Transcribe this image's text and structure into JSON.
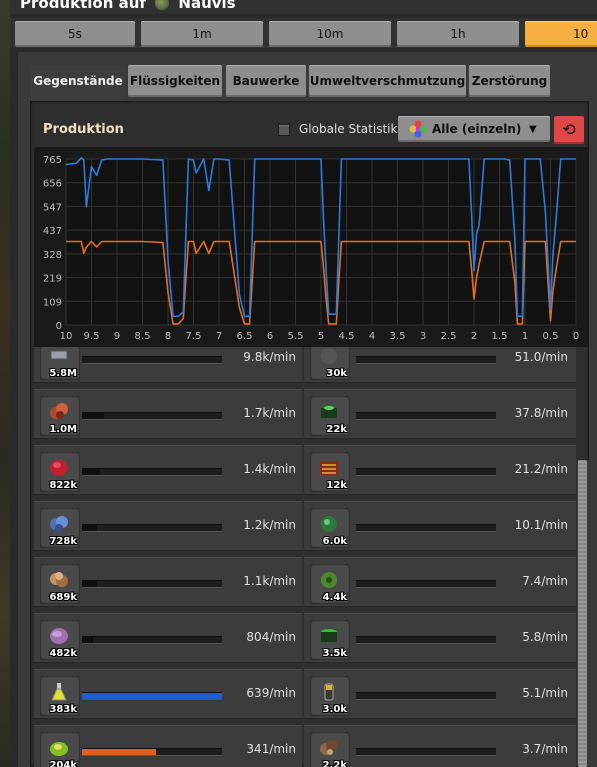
{
  "window": {
    "title": "Produktion auf",
    "planet_name": "Nauvis"
  },
  "time_buttons": [
    {
      "label": "5s",
      "active": false
    },
    {
      "label": "1m",
      "active": false
    },
    {
      "label": "10m",
      "active": false
    },
    {
      "label": "1h",
      "active": false
    },
    {
      "label": "10",
      "active": true
    }
  ],
  "tabs": [
    {
      "label": "Gegenstände",
      "active": true
    },
    {
      "label": "Flüssigkeiten",
      "active": false
    },
    {
      "label": "Bauwerke",
      "active": false
    },
    {
      "label": "Umweltverschmutzung",
      "active": false
    },
    {
      "label": "Zerstörung",
      "active": false
    }
  ],
  "production": {
    "title": "Produktion",
    "global_stats_label": "Globale Statistik",
    "global_stats_checked": false,
    "filter_selected": "Alle (einzeln)",
    "reset_icon": "reset-icon"
  },
  "chart_data": {
    "type": "line",
    "y_ticks": [
      "765",
      "656",
      "547",
      "437",
      "328",
      "219",
      "109",
      "0"
    ],
    "x_ticks": [
      "10",
      "9.5",
      "9",
      "8.5",
      "8",
      "7.5",
      "7",
      "6.5",
      "6",
      "5.5",
      "5",
      "4.5",
      "4",
      "3.5",
      "3",
      "2.5",
      "2",
      "1.5",
      "1",
      "0.5",
      "0"
    ],
    "ylim": [
      0,
      765
    ],
    "xlim": [
      10,
      0
    ],
    "grid": true,
    "series": [
      {
        "color": "#2e7bdc",
        "x": [
          10,
          9.8,
          9.7,
          9.65,
          9.6,
          9.5,
          9.4,
          9.3,
          9.2,
          8.5,
          8.1,
          8.0,
          7.9,
          7.8,
          7.7,
          7.6,
          7.5,
          7.45,
          7.3,
          7.2,
          7.1,
          7.0,
          6.8,
          6.6,
          6.5,
          6.4,
          6.3,
          6.1,
          6.0,
          5.9,
          5.8,
          5.0,
          4.95,
          4.9,
          4.85,
          4.7,
          4.65,
          4.6,
          4.5,
          4.0,
          2.1,
          2.05,
          2.0,
          1.95,
          1.9,
          1.8,
          1.4,
          1.3,
          1.2,
          1.15,
          1.05,
          1.0,
          0.9,
          0.7,
          0.6,
          0.5,
          0.45,
          0.4,
          0.3,
          0.0
        ],
        "y": [
          740,
          745,
          770,
          760,
          545,
          730,
          690,
          760,
          765,
          765,
          760,
          300,
          40,
          40,
          60,
          765,
          760,
          700,
          765,
          620,
          765,
          765,
          760,
          140,
          40,
          40,
          765,
          765,
          765,
          765,
          765,
          765,
          480,
          250,
          50,
          50,
          400,
          765,
          765,
          765,
          765,
          520,
          250,
          420,
          460,
          765,
          765,
          760,
          400,
          40,
          40,
          765,
          765,
          765,
          520,
          70,
          330,
          460,
          765,
          765
        ]
      },
      {
        "color": "#e07020",
        "x": [
          10,
          9.7,
          9.65,
          9.6,
          9.5,
          9.4,
          9.3,
          8.5,
          8.1,
          8.0,
          7.9,
          7.8,
          7.7,
          7.6,
          7.5,
          7.45,
          7.3,
          7.2,
          7.1,
          7.0,
          6.8,
          6.6,
          6.5,
          6.4,
          6.3,
          6.1,
          5.0,
          4.95,
          4.9,
          4.85,
          4.7,
          4.65,
          4.6,
          4.5,
          2.1,
          2.05,
          2.0,
          1.95,
          1.9,
          1.8,
          1.3,
          1.2,
          1.15,
          1.05,
          1.0,
          0.9,
          0.6,
          0.5,
          0.45,
          0.4,
          0.3,
          0.0
        ],
        "y": [
          385,
          385,
          330,
          360,
          385,
          360,
          385,
          385,
          380,
          150,
          5,
          5,
          30,
          385,
          385,
          330,
          385,
          330,
          385,
          385,
          385,
          80,
          5,
          5,
          385,
          385,
          385,
          260,
          120,
          5,
          5,
          200,
          385,
          385,
          385,
          260,
          120,
          220,
          280,
          385,
          385,
          200,
          5,
          5,
          385,
          385,
          385,
          20,
          160,
          240,
          385,
          385
        ]
      }
    ]
  },
  "items": [
    {
      "left_count": "5.8M",
      "left_icon": "iron-plate-icon",
      "left_fill": 0.95,
      "left_fill_color": "#1b1b1b",
      "left_rate": "9.8k/min",
      "right_count": "30k",
      "right_icon": "stone-icon",
      "right_fill": 0.0,
      "right_fill_color": "#2a2a2a",
      "right_rate": "51.0/min"
    },
    {
      "left_count": "1.0M",
      "left_icon": "copper-ore-icon",
      "left_fill": 0.16,
      "left_fill_color": "#101010",
      "left_rate": "1.7k/min",
      "right_count": "22k",
      "right_icon": "green-barrel-icon",
      "right_fill": 0.0,
      "right_fill_color": "#2a2a2a",
      "right_rate": "37.8/min"
    },
    {
      "left_count": "822k",
      "left_icon": "copper-plate-icon",
      "left_fill": 0.13,
      "left_fill_color": "#101010",
      "left_rate": "1.4k/min",
      "right_count": "12k",
      "right_icon": "circuit-icon",
      "right_fill": 0.0,
      "right_fill_color": "#2a2a2a",
      "right_rate": "21.2/min"
    },
    {
      "left_count": "728k",
      "left_icon": "iron-ore-icon",
      "left_fill": 0.11,
      "left_fill_color": "#101010",
      "left_rate": "1.2k/min",
      "right_count": "6.0k",
      "right_icon": "green-orb-icon",
      "right_fill": 0.0,
      "right_fill_color": "#2a2a2a",
      "right_rate": "10.1/min"
    },
    {
      "left_count": "689k",
      "left_icon": "wood-icon",
      "left_fill": 0.11,
      "left_fill_color": "#101010",
      "left_rate": "1.1k/min",
      "right_count": "4.4k",
      "right_icon": "green-gear-icon",
      "right_fill": 0.0,
      "right_fill_color": "#2a2a2a",
      "right_rate": "7.4/min"
    },
    {
      "left_count": "482k",
      "left_icon": "pink-ore-icon",
      "left_fill": 0.08,
      "left_fill_color": "#101010",
      "left_rate": "804/min",
      "right_count": "3.5k",
      "right_icon": "green-canister-icon",
      "right_fill": 0.0,
      "right_fill_color": "#2a2a2a",
      "right_rate": "5.8/min"
    },
    {
      "left_count": "383k",
      "left_icon": "yellow-flask-icon",
      "left_fill": 1.0,
      "left_fill_color": "#1f5ed0",
      "left_rate": "639/min",
      "right_count": "3.0k",
      "right_icon": "battery-icon",
      "right_fill": 0.0,
      "right_fill_color": "#2a2a2a",
      "right_rate": "5.1/min"
    },
    {
      "left_count": "204k",
      "left_icon": "green-blob-icon",
      "left_fill": 0.53,
      "left_fill_color": "#e06020",
      "left_rate": "341/min",
      "right_count": "2.2k",
      "right_icon": "ore-chunk-icon",
      "right_fill": 0.0,
      "right_fill_color": "#2a2a2a",
      "right_rate": "3.7/min"
    }
  ]
}
